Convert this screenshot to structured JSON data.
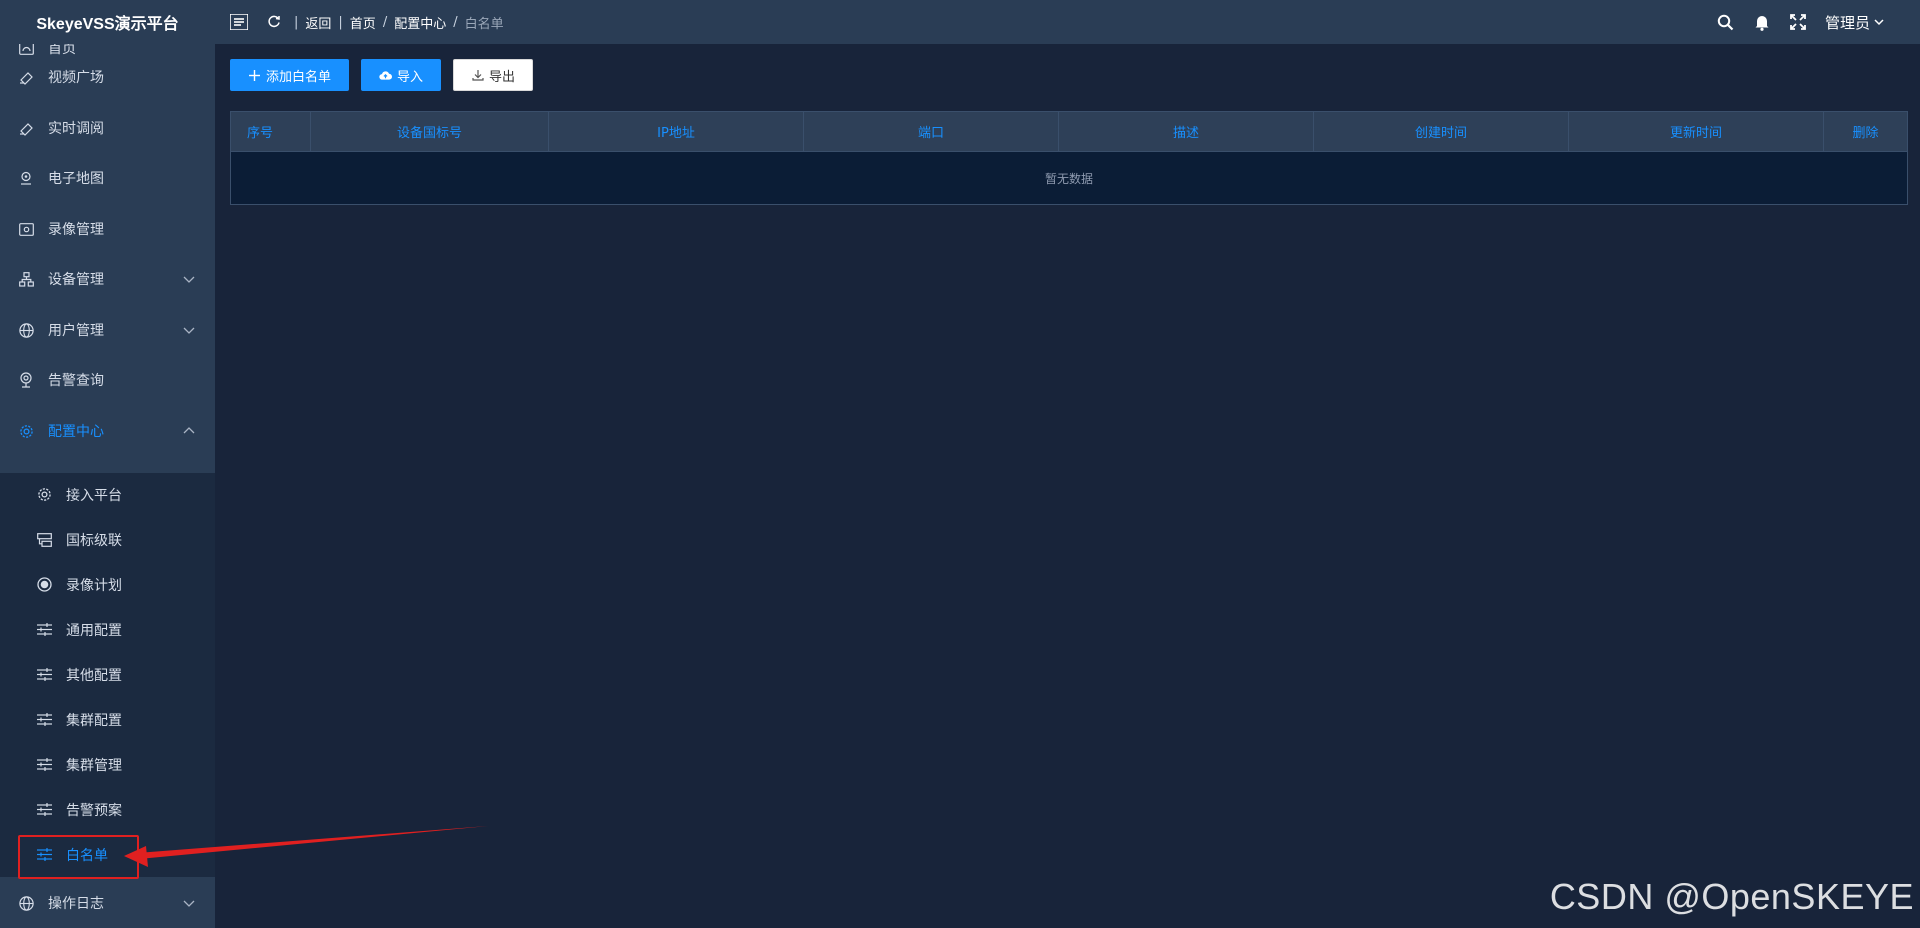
{
  "app": {
    "title": "SkeyeVSS演示平台"
  },
  "breadcrumb": {
    "back": "返回",
    "items": [
      "首页",
      "配置中心"
    ],
    "current": "白名单"
  },
  "header": {
    "user": "管理员"
  },
  "sidebar": {
    "items": [
      {
        "label": "首页",
        "icon": "dashboard-icon"
      },
      {
        "label": "视频广场",
        "icon": "video-plaza-icon"
      },
      {
        "label": "实时调阅",
        "icon": "live-view-icon"
      },
      {
        "label": "电子地图",
        "icon": "map-pin-icon"
      },
      {
        "label": "录像管理",
        "icon": "recording-icon"
      },
      {
        "label": "设备管理",
        "icon": "device-tree-icon"
      },
      {
        "label": "用户管理",
        "icon": "globe-icon"
      },
      {
        "label": "告警查询",
        "icon": "alarm-icon"
      },
      {
        "label": "配置中心",
        "icon": "gear-icon"
      }
    ],
    "sub_items": [
      {
        "label": "接入平台",
        "icon": "gear-icon"
      },
      {
        "label": "国标级联",
        "icon": "cascade-icon"
      },
      {
        "label": "录像计划",
        "icon": "record-dot-icon"
      },
      {
        "label": "通用配置",
        "icon": "sliders-icon"
      },
      {
        "label": "其他配置",
        "icon": "sliders-icon"
      },
      {
        "label": "集群配置",
        "icon": "sliders-icon"
      },
      {
        "label": "集群管理",
        "icon": "sliders-icon"
      },
      {
        "label": "告警预案",
        "icon": "sliders-icon"
      },
      {
        "label": "白名单",
        "icon": "sliders-icon"
      }
    ],
    "bottom_item": {
      "label": "操作日志",
      "icon": "globe-icon"
    }
  },
  "toolbar": {
    "add_label": "添加白名单",
    "import_label": "导入",
    "export_label": "导出"
  },
  "table": {
    "columns": [
      "序号",
      "设备国标号",
      "IP地址",
      "端口",
      "描述",
      "创建时间",
      "更新时间",
      "删除"
    ],
    "empty_text": "暂无数据"
  },
  "watermark": "CSDN @OpenSKEYE",
  "colors": {
    "accent": "#1890ff",
    "sidebar_bg": "#2a3d55",
    "content_bg": "#18243a",
    "annotation": "#e02020"
  }
}
